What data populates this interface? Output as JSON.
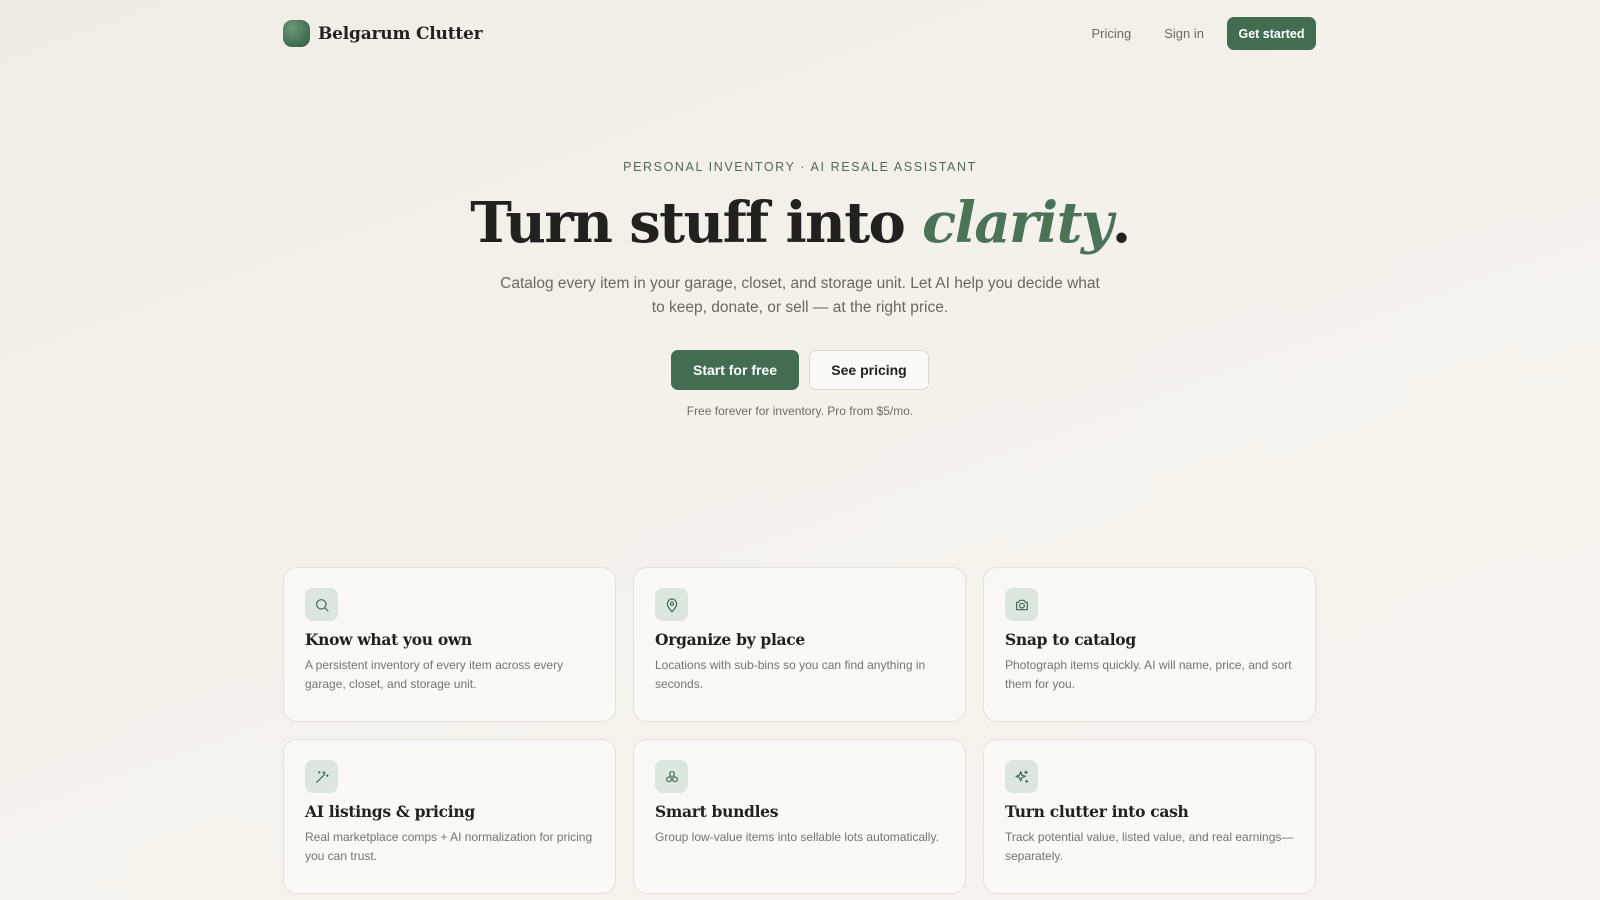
{
  "header": {
    "brand": "Belgarum Clutter",
    "nav": {
      "pricing": "Pricing",
      "sign_in": "Sign in",
      "get_started": "Get started"
    }
  },
  "hero": {
    "eyebrow": "PERSONAL INVENTORY · AI RESALE ASSISTANT",
    "headline_main": "Turn stuff into ",
    "headline_accent": "clarity",
    "headline_end": ".",
    "subtitle": "Catalog every item in your garage, closet, and storage unit. Let AI help you decide what to keep, donate, or sell — at the right price.",
    "cta_primary": "Start for free",
    "cta_secondary": "See pricing",
    "fine_print": "Free forever for inventory. Pro from $5/mo."
  },
  "features": [
    {
      "icon": "search-icon",
      "title": "Know what you own",
      "text": "A persistent inventory of every item across every garage, closet, and storage unit."
    },
    {
      "icon": "map-pin-icon",
      "title": "Organize by place",
      "text": "Locations with sub-bins so you can find anything in seconds."
    },
    {
      "icon": "camera-icon",
      "title": "Snap to catalog",
      "text": "Photograph items quickly. AI will name, price, and sort them for you."
    },
    {
      "icon": "magic-wand-icon",
      "title": "AI listings & pricing",
      "text": "Real marketplace comps + AI normalization for pricing you can trust."
    },
    {
      "icon": "boxes-icon",
      "title": "Smart bundles",
      "text": "Group low-value items into sellable lots automatically."
    },
    {
      "icon": "sparkles-icon",
      "title": "Turn clutter into cash",
      "text": "Track potential value, listed value, and real earnings—separately."
    }
  ],
  "colors": {
    "accent": "#436d53",
    "icon_bg": "#dbe7de",
    "background": "#f3f0ea"
  }
}
